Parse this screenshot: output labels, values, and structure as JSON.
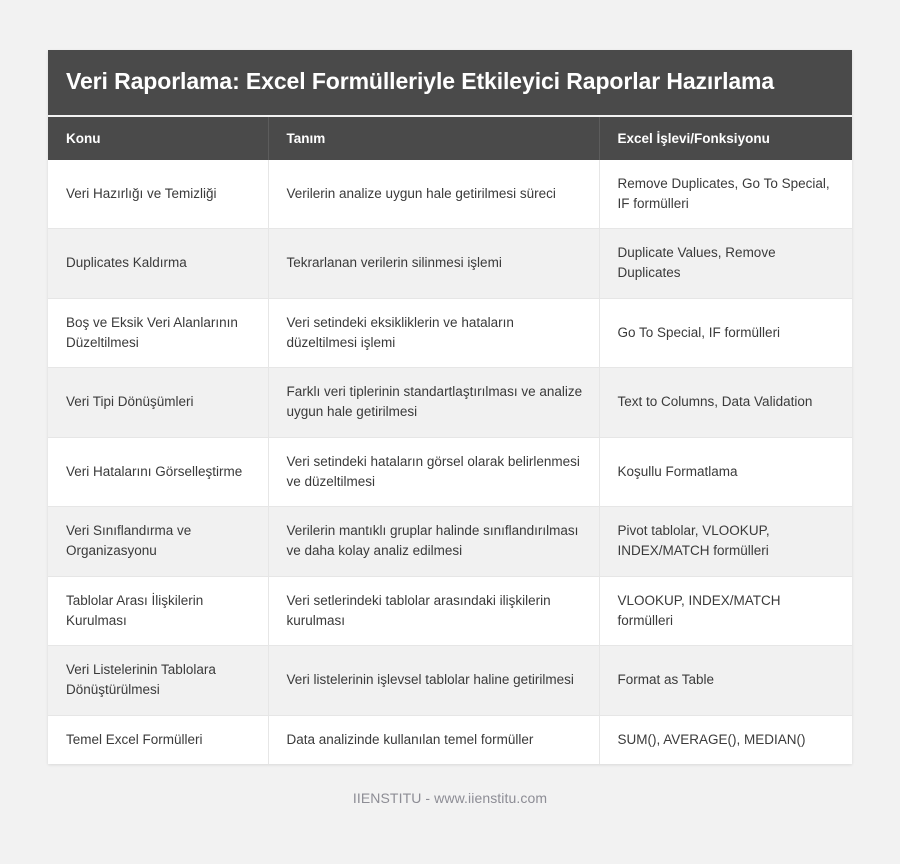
{
  "header": {
    "title": "Veri Raporlama: Excel Formülleriyle Etkileyici Raporlar Hazırlama",
    "background_color": "#4a4a4a",
    "text_color": "#ffffff"
  },
  "table": {
    "columns": [
      "Konu",
      "Tanım",
      "Excel İşlevi/Fonksiyonu"
    ],
    "rows": [
      {
        "konu": "Veri Hazırlığı ve Temizliği",
        "tanim": "Verilerin analize uygun hale getirilmesi süreci",
        "islev": "Remove Duplicates, Go To Special, IF formülleri"
      },
      {
        "konu": "Duplicates Kaldırma",
        "tanim": "Tekrarlanan verilerin silinmesi işlemi",
        "islev": "Duplicate Values, Remove Duplicates"
      },
      {
        "konu": "Boş ve Eksik Veri Alanlarının Düzeltilmesi",
        "tanim": "Veri setindeki eksikliklerin ve hataların düzeltilmesi işlemi",
        "islev": "Go To Special, IF formülleri"
      },
      {
        "konu": "Veri Tipi Dönüşümleri",
        "tanim": "Farklı veri tiplerinin standartlaştırılması ve analize uygun hale getirilmesi",
        "islev": "Text to Columns, Data Validation"
      },
      {
        "konu": "Veri Hatalarını Görselleştirme",
        "tanim": "Veri setindeki hataların görsel olarak belirlenmesi ve düzeltilmesi",
        "islev": "Koşullu Formatlama"
      },
      {
        "konu": "Veri Sınıflandırma ve Organizasyonu",
        "tanim": "Verilerin mantıklı gruplar halinde sınıflandırılması ve daha kolay analiz edilmesi",
        "islev": "Pivot tablolar, VLOOKUP, INDEX/MATCH formülleri"
      },
      {
        "konu": "Tablolar Arası İlişkilerin Kurulması",
        "tanim": "Veri setlerindeki tablolar arasındaki ilişkilerin kurulması",
        "islev": "VLOOKUP, INDEX/MATCH formülleri"
      },
      {
        "konu": "Veri Listelerinin Tablolara Dönüştürülmesi",
        "tanim": "Veri listelerinin işlevsel tablolar haline getirilmesi",
        "islev": "Format as Table"
      },
      {
        "konu": "Temel Excel Formülleri",
        "tanim": "Data analizinde kullanılan temel formüller",
        "islev": "SUM(), AVERAGE(), MEDIAN()"
      }
    ],
    "row_colors": {
      "odd": "#ffffff",
      "even": "#f1f1f1",
      "border": "#e6e6e6"
    }
  },
  "footer": {
    "text": "IIENSTITU - www.iienstitu.com",
    "color": "#8d8d95"
  },
  "page": {
    "background_color": "#f2f2f2"
  }
}
